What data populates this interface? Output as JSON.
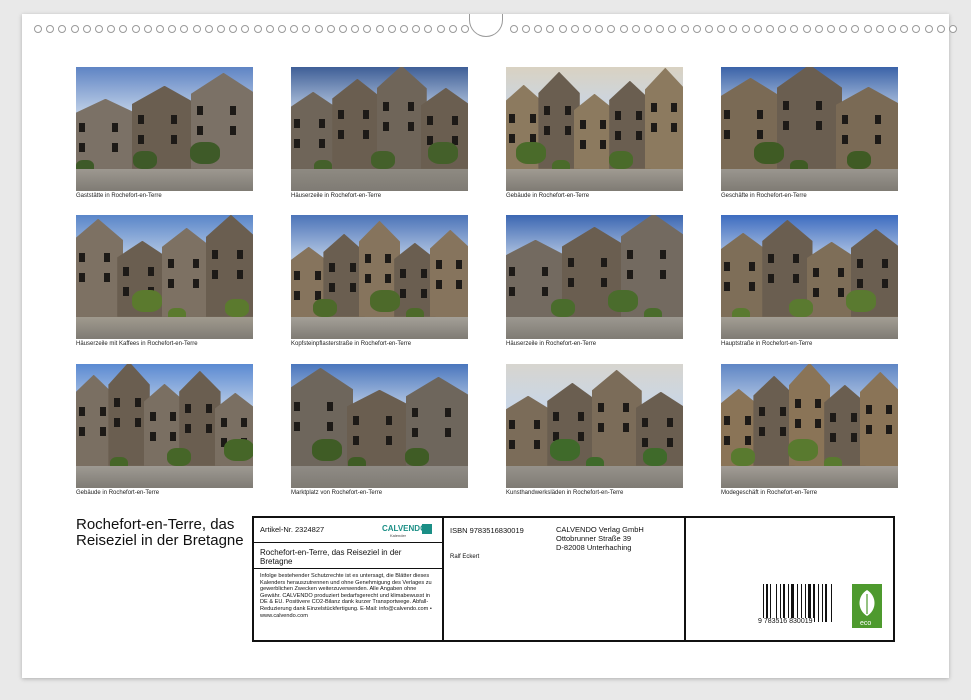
{
  "photos": [
    {
      "caption": "Gaststätte in Rochefort-en-Terre"
    },
    {
      "caption": "Häuserzeile in Rochefort-en-Terre"
    },
    {
      "caption": "Gebäude in Rochefort-en-Terre"
    },
    {
      "caption": "Geschäfte in Rochefort-en-Terre"
    },
    {
      "caption": "Häuserzeile mit Kaffees in Rochefort-en-Terre"
    },
    {
      "caption": "Kopfsteinpflasterstraße in Rochefort-en-Terre"
    },
    {
      "caption": "Häuserzeile in Rochefort-en-Terre"
    },
    {
      "caption": "Hauptstraße in Rochefort-en-Terre"
    },
    {
      "caption": "Gebäude in Rochefort-en-Terre"
    },
    {
      "caption": "Marktplatz von Rochefort-en-Terre"
    },
    {
      "caption": "Kunsthandwerksläden in Rochefort-en-Terre"
    },
    {
      "caption": "Modegeschäft in Rochefort-en-Terre"
    }
  ],
  "title": "Rochefort-en-Terre, das Reiseziel in der Bretagne",
  "info": {
    "article_label": "Artikel-Nr. 2324827",
    "logo_text": "CALVENDO",
    "logo_subtext": "Kalender",
    "isbn": "ISBN 9783516830019",
    "publisher_line1": "CALVENDO Verlag GmbH",
    "publisher_line2": "Ottobrunner Straße 39",
    "publisher_line3": "D-82008 Unterhaching",
    "calendar_title": "Rochefort-en-Terre, das Reiseziel in der Bretagne",
    "author": "Ralf Eckert",
    "legal_text": "Infolge bestehender Schutzrechte ist es untersagt, die Blätter dieses Kalenders herauszutrennen und ohne Genehmigung des Verlages zu gewerblichen Zwecken weiterzuverwenden. Alle Angaben ohne Gewähr. CALVENDO produziert bedarfsgerecht und klimabewusst in DE & EU. Positivere CO2-Bilanz dank kurzer Transportwege. Abfall-Reduzierung dank Einzelstückfertigung. E-Mail: info@calvendo.com • www.calvendo.com",
    "barcode_number": "9 783516 830019",
    "eco_label": "eco"
  },
  "colors": {
    "sky": "#4a78b8",
    "stone": "#8a7a66",
    "cobble": "#9a958d",
    "foliage": "#4f6a2c",
    "eco_green": "#4e9a2e",
    "calvendo_teal": "#1b8f86"
  }
}
